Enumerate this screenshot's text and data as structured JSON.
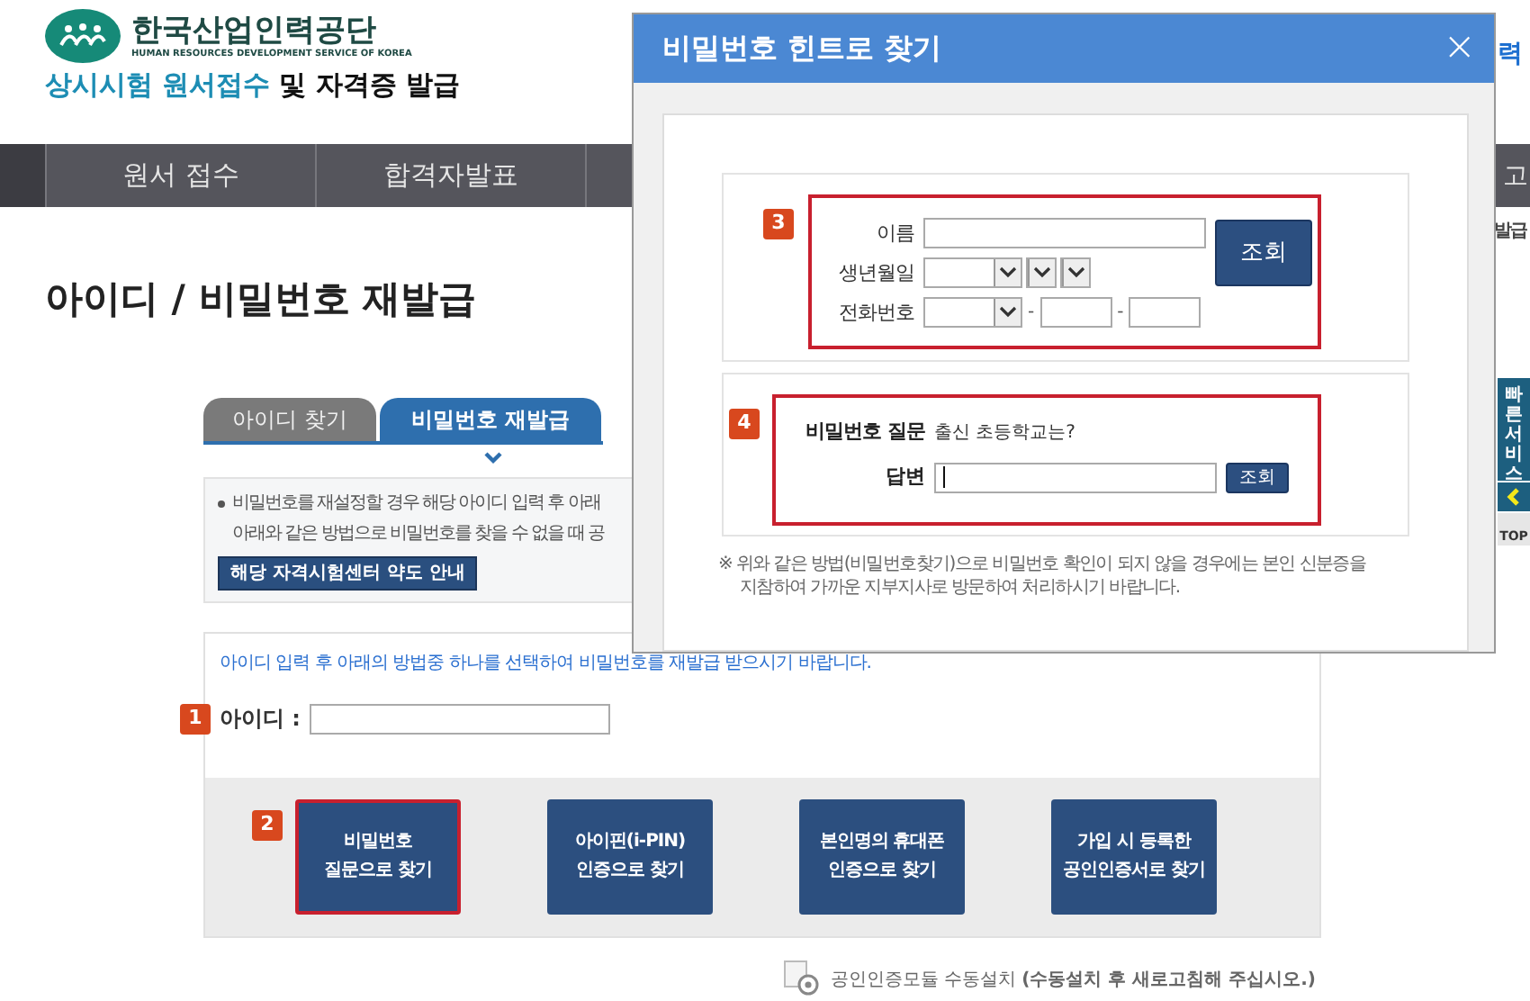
{
  "header": {
    "org_name": "한국산업인력공단",
    "org_subtitle": "HUMAN RESOURCES DEVELOPMENT SERVICE OF KOREA",
    "site_title_highlight": "상시시험 원서접수",
    "site_title_rest": "및 자격증 발급"
  },
  "nav": [
    {
      "label": "원서 접수"
    },
    {
      "label": "합격자발표"
    }
  ],
  "page_title": "아이디 / 비밀번호 재발급",
  "tabs": [
    {
      "label": "아이디 찾기",
      "selected": false
    },
    {
      "label": "비밀번호 재발급",
      "selected": true
    }
  ],
  "info": {
    "lines": [
      "비밀번호를 재설정할 경우 해당 아이디 입력 후 아래",
      "아래와 같은 방법으로 비밀번호를 찾을 수 없을 때 공"
    ],
    "button": "해당 자격시험센터 약도 안내"
  },
  "instruction": "아이디 입력 후 아래의 방법중 하나를 선택하여 비밀번호를 재발급 받으시기 바랍니다.",
  "id_field": {
    "step": "1",
    "label": "아이디 :"
  },
  "methods_step": "2",
  "methods": [
    {
      "lines": [
        "비밀번호",
        "질문으로 찾기"
      ],
      "selected": true
    },
    {
      "lines": [
        "아이핀(i-PIN)",
        "인증으로 찾기"
      ],
      "selected": false
    },
    {
      "lines": [
        "본인명의 휴대폰",
        "인증으로 찾기"
      ],
      "selected": false
    },
    {
      "lines": [
        "가입 시 등록한",
        "공인인증서로 찾기"
      ],
      "selected": false
    }
  ],
  "footer_note": "공인인증모듈 수동설치 **(수동설치 후 새로고침해 주십시오.)**",
  "right_edge": {
    "top_link": "력",
    "nav_item": "고",
    "side_text": "발급"
  },
  "quick_service": {
    "label": "빠른서비스",
    "top": "TOP"
  },
  "dialog": {
    "title": "비밀번호 힌트로 찾기",
    "close": "×",
    "section_3": {
      "step": "3",
      "name_label": "이름",
      "birth_label": "생년월일",
      "phone_label": "전화번호",
      "separator": "-",
      "button": "조회"
    },
    "section_4": {
      "step": "4",
      "question_label": "비밀번호 질문",
      "question": "출신 초등학교는?",
      "answer_label": "답변",
      "button": "조회"
    },
    "note": [
      "※ 위와 같은 방법(비밀번호찾기)으로 비밀번호 확인이 되지 않을 경우에는 본인 신분증을",
      "지참하여 가까운 지부지사로 방문하여 처리하시기 바랍니다."
    ]
  }
}
